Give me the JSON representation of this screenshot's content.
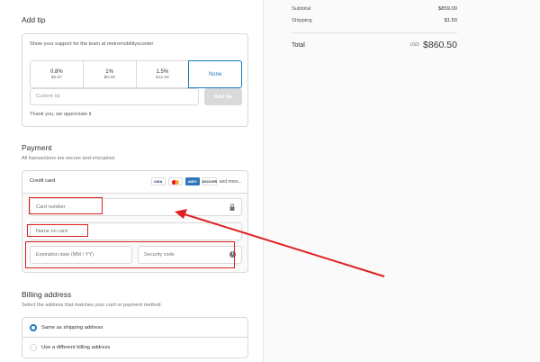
{
  "tip": {
    "title": "Add tip",
    "support_text": "Show your support for the team at metromobilityscooter",
    "options": [
      {
        "pct": "0.8%",
        "amount": "$6.87"
      },
      {
        "pct": "1%",
        "amount": "$8.59"
      },
      {
        "pct": "1.5%",
        "amount": "$12.89"
      },
      {
        "pct": "None",
        "amount": ""
      }
    ],
    "custom_placeholder": "Custom tip",
    "add_button": "Add tip",
    "thanks": "Thank you, we appreciate it"
  },
  "payment": {
    "title": "Payment",
    "subtitle": "All transactions are secure and encrypted.",
    "method_label": "Credit card",
    "logos": [
      "VISA",
      "",
      "AMEX",
      "DISCOVER"
    ],
    "and_more": "and more...",
    "card_number_placeholder": "Card number",
    "name_placeholder": "Name on card",
    "expiration_placeholder": "Expiration date (MM / YY)",
    "security_placeholder": "Security code"
  },
  "billing": {
    "title": "Billing address",
    "subtitle": "Select the address that matches your card or payment method.",
    "options": [
      "Same as shipping address",
      "Use a different billing address"
    ]
  },
  "summary": {
    "subtotal_label": "Subtotal",
    "subtotal_value": "$859.00",
    "shipping_label": "Shipping",
    "shipping_value": "$1.50",
    "total_label": "Total",
    "currency": "USD",
    "total_value": "$860.50"
  },
  "colors": {
    "accent": "#197bbd",
    "annotation": "#e02020"
  }
}
